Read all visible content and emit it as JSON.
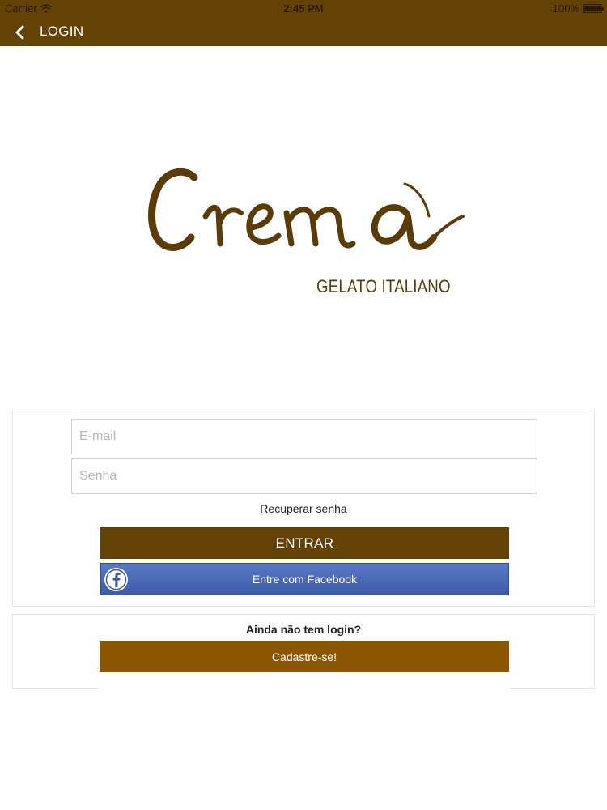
{
  "status_bar": {
    "carrier": "Carrier",
    "time": "2:45 PM",
    "battery": "100%"
  },
  "nav": {
    "title": "LOGIN",
    "back_icon": "chevron-left-icon"
  },
  "brand": {
    "logo_alt": "Crema",
    "tagline": "GELATO ITALIANO",
    "color": "#5a3c0a"
  },
  "login_form": {
    "email_placeholder": "E-mail",
    "password_placeholder": "Senha",
    "recover_label": "Recuperar senha",
    "enter_label": "ENTRAR",
    "facebook_label": "Entre com Facebook"
  },
  "signup": {
    "question": "Ainda não tem login?",
    "button_label": "Cadastre-se!"
  },
  "colors": {
    "primary": "#644206",
    "secondary": "#8c5502",
    "facebook": "#4a69b6"
  }
}
